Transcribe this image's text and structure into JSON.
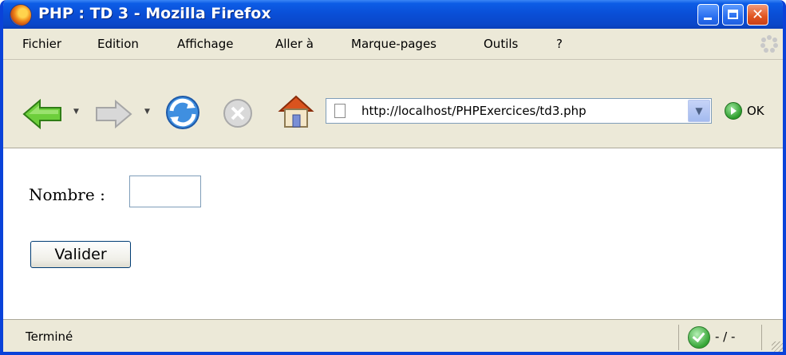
{
  "window": {
    "title": "PHP : TD 3 - Mozilla Firefox"
  },
  "menu": {
    "items": [
      "Fichier",
      "Edition",
      "Affichage",
      "Aller à",
      "Marque-pages",
      "Outils",
      "?"
    ]
  },
  "navigation": {
    "url": "http://localhost/PHPExercices/td3.php",
    "go_label": "OK",
    "icons": {
      "back": "back-arrow-icon",
      "forward": "forward-arrow-icon",
      "reload": "reload-icon",
      "stop": "stop-icon",
      "home": "home-icon",
      "go": "go-icon"
    }
  },
  "form": {
    "field_label": "Nombre :",
    "field_value": "",
    "submit_label": "Valider"
  },
  "status": {
    "text": "Terminé",
    "zone": "- / -"
  },
  "colors": {
    "titlebar": "#0a4ed6",
    "chrome": "#ece9d8",
    "close_button": "#e0541f"
  }
}
